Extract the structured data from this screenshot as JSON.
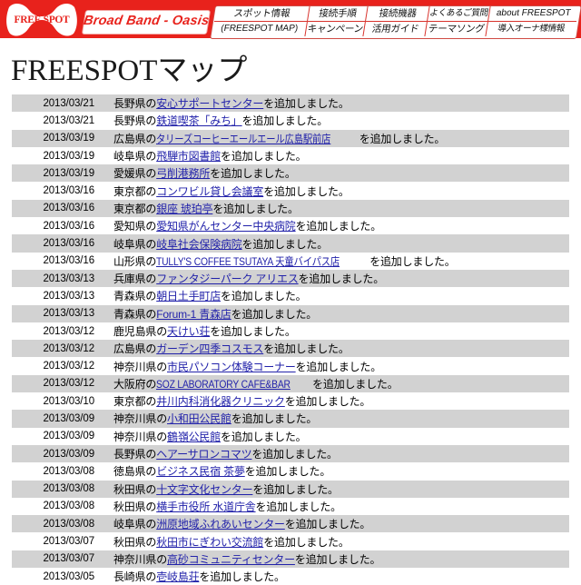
{
  "header": {
    "logo_text_1": "FREE",
    "logo_text_2": "SPOT",
    "logo_icon": "freespot-bowtie-logo",
    "tagline": "Broad Band - Oasis",
    "bg_color": "#e8221c",
    "nav": [
      {
        "name": "spot-info",
        "line1": "スポット情報",
        "line2": "(FREESPOT MAP)"
      },
      {
        "name": "connection-steps",
        "line1": "接続手順",
        "line2": "キャンペーン"
      },
      {
        "name": "connection-devices",
        "line1": "接続機器",
        "line2": "活用ガイド"
      },
      {
        "name": "faq",
        "line1": "よくあるご質問",
        "line2": "テーマソング"
      },
      {
        "name": "about-freespot",
        "line1": "about FREESPOT",
        "line2": "導入オーナ様情報"
      }
    ]
  },
  "page": {
    "title": "FREESPOTマップ"
  },
  "list": {
    "rows": [
      {
        "date": "2013/03/21",
        "prefix": "長野県の",
        "link": "安心サポートセンター",
        "suffix": "を追加しました。"
      },
      {
        "date": "2013/03/21",
        "prefix": "長野県の",
        "link": "鉄道喫茶「みち」",
        "suffix": "を追加しました。"
      },
      {
        "date": "2013/03/19",
        "prefix": "広島県の",
        "link": "タリーズコーヒーエールエール広島駅前店",
        "suffix": "を追加しました。"
      },
      {
        "date": "2013/03/19",
        "prefix": "岐阜県の",
        "link": "飛騨市図書館",
        "suffix": "を追加しました。"
      },
      {
        "date": "2013/03/19",
        "prefix": "愛媛県の",
        "link": "弓削港務所",
        "suffix": "を追加しました。"
      },
      {
        "date": "2013/03/16",
        "prefix": "東京都の",
        "link": "コンワビル貸し会議室",
        "suffix": "を追加しました。"
      },
      {
        "date": "2013/03/16",
        "prefix": "東京都の",
        "link": "銀座 琥珀亭",
        "suffix": "を追加しました。"
      },
      {
        "date": "2013/03/16",
        "prefix": "愛知県の",
        "link": "愛知県がんセンター中央病院",
        "suffix": "を追加しました。"
      },
      {
        "date": "2013/03/16",
        "prefix": "岐阜県の",
        "link": "岐阜社会保険病院",
        "suffix": "を追加しました。"
      },
      {
        "date": "2013/03/16",
        "prefix": "山形県の",
        "link": "TULLY'S COFFEE TSUTAYA 天童バイパス店",
        "suffix": "を追加しました。"
      },
      {
        "date": "2013/03/13",
        "prefix": "兵庫県の",
        "link": "ファンタジーパーク アリエス",
        "suffix": "を追加しました。"
      },
      {
        "date": "2013/03/13",
        "prefix": "青森県の",
        "link": "朝日土手町店",
        "suffix": "を追加しました。"
      },
      {
        "date": "2013/03/13",
        "prefix": "青森県の",
        "link": "Forum-1 青森店",
        "suffix": "を追加しました。"
      },
      {
        "date": "2013/03/12",
        "prefix": "鹿児島県の",
        "link": "天けい荘",
        "suffix": "を追加しました。"
      },
      {
        "date": "2013/03/12",
        "prefix": "広島県の",
        "link": "ガーデン四季コスモス",
        "suffix": "を追加しました。"
      },
      {
        "date": "2013/03/12",
        "prefix": "神奈川県の",
        "link": "市民パソコン体験コーナー",
        "suffix": "を追加しました。"
      },
      {
        "date": "2013/03/12",
        "prefix": "大阪府の",
        "link": "SOZ LABORATORY CAFE&BAR",
        "suffix": "を追加しました。"
      },
      {
        "date": "2013/03/10",
        "prefix": "東京都の",
        "link": "井川内科消化器クリニック",
        "suffix": "を追加しました。"
      },
      {
        "date": "2013/03/09",
        "prefix": "神奈川県の",
        "link": "小和田公民館",
        "suffix": "を追加しました。"
      },
      {
        "date": "2013/03/09",
        "prefix": "神奈川県の",
        "link": "鶴嶺公民館",
        "suffix": "を追加しました。"
      },
      {
        "date": "2013/03/09",
        "prefix": "長野県の",
        "link": "ヘアーサロンコマツ",
        "suffix": "を追加しました。"
      },
      {
        "date": "2013/03/08",
        "prefix": "徳島県の",
        "link": "ビジネス民宿 茶夢",
        "suffix": "を追加しました。"
      },
      {
        "date": "2013/03/08",
        "prefix": "秋田県の",
        "link": "十文字文化センター",
        "suffix": "を追加しました。"
      },
      {
        "date": "2013/03/08",
        "prefix": "秋田県の",
        "link": "横手市役所 水道庁舎",
        "suffix": "を追加しました。"
      },
      {
        "date": "2013/03/08",
        "prefix": "岐阜県の",
        "link": "洲原地域ふれあいセンター",
        "suffix": "を追加しました。"
      },
      {
        "date": "2013/03/07",
        "prefix": "秋田県の",
        "link": "秋田市にぎわい交流館",
        "suffix": "を追加しました。"
      },
      {
        "date": "2013/03/07",
        "prefix": "神奈川県の",
        "link": "高砂コミュニティセンター",
        "suffix": "を追加しました。"
      },
      {
        "date": "2013/03/05",
        "prefix": "長崎県の",
        "link": "壱岐島荘",
        "suffix": "を追加しました。"
      }
    ]
  }
}
